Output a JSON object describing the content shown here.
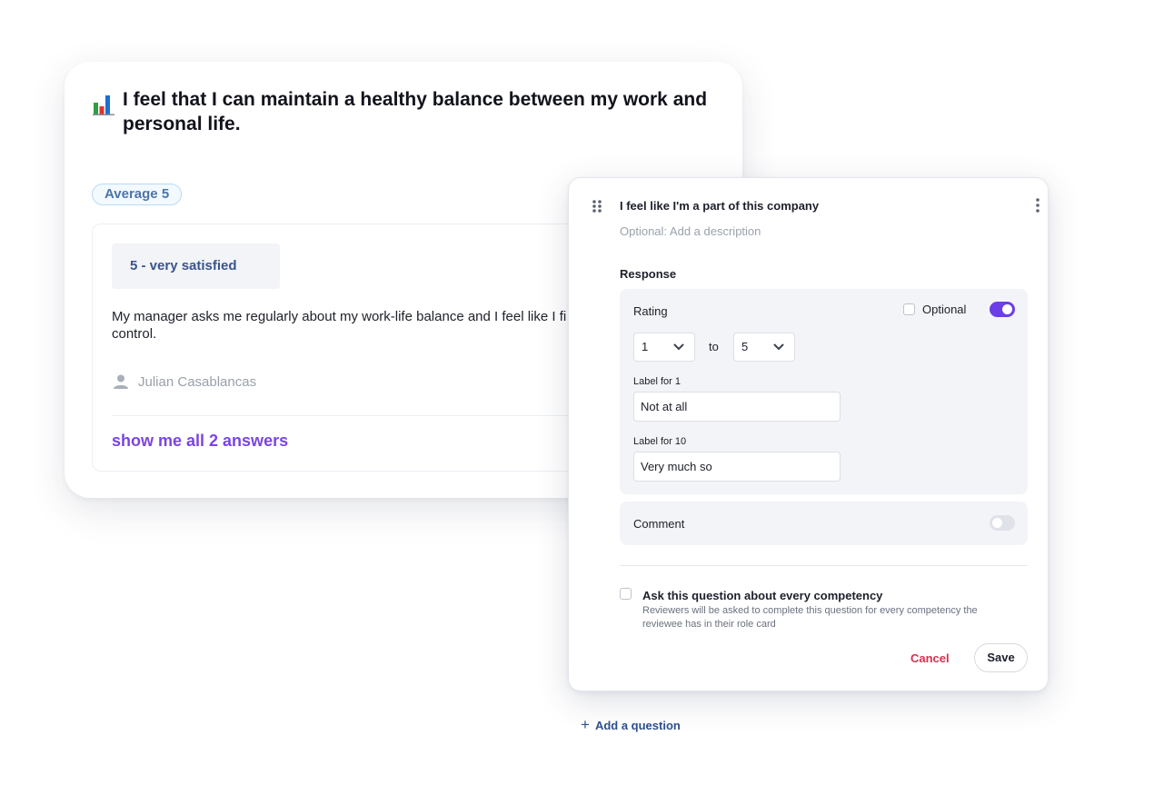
{
  "survey_card": {
    "question": "I feel that I can maintain a healthy balance between my work and personal life.",
    "icon": "bar-chart-icon",
    "average_badge": "Average 5",
    "answer": {
      "rating_label": "5 - very satisfied",
      "text": "My manager asks me regularly about my work-life balance and I feel like I fi",
      "text_line2": "control.",
      "author": "Julian Casablancas"
    },
    "show_all_label": "show me all 2 answers"
  },
  "editor": {
    "question_title": "I feel like I'm a part of this company",
    "description_placeholder": "Optional: Add a description",
    "response_label": "Response",
    "rating": {
      "label": "Rating",
      "optional_label": "Optional",
      "optional_checked": false,
      "enabled": true,
      "from_value": "1",
      "to_label": "to",
      "to_value": "5",
      "label_for_min": "Label for 1",
      "min_value": "Not at all",
      "label_for_max": "Label for 10",
      "max_value": "Very much so"
    },
    "comment": {
      "label": "Comment",
      "enabled": false
    },
    "competency": {
      "title": "Ask this question about every competency",
      "description": "Reviewers will be asked to complete this question for every competency the reviewee has in their role card",
      "checked": false
    },
    "cancel_label": "Cancel",
    "save_label": "Save"
  },
  "add_question_label": "Add a question",
  "colors": {
    "accent_purple": "#6b3ee6",
    "link_purple": "#7b45e0",
    "cancel_red": "#d6304f",
    "badge_blue": "#4d74a8"
  }
}
